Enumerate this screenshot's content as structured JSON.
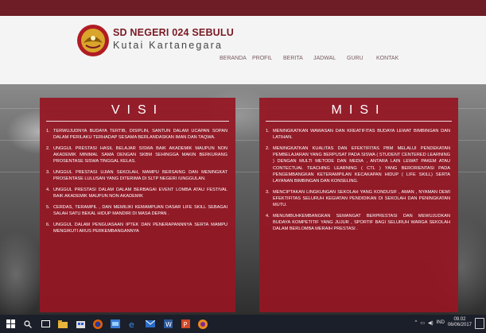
{
  "brand": {
    "name": "SD NEGERI 024 SEBULU",
    "subtitle": "Kutai Kartanegara"
  },
  "nav": [
    "BERANDA",
    "PROFIL",
    "BERITA",
    "JADWAL",
    "GURU",
    "KONTAK"
  ],
  "visi": {
    "title": "VISI",
    "items": [
      "TERWUJUDNYA BUDAYA TERTIB, DISIPLIN, SANTUN DALAM UCAPAN SOPAN DALAM PERILAKU TERHADAP SESAMA BERLANDASKAN IMAN DAN TAQWA.",
      "UNGGUL PRESTASI HASIL BELAJAR SISWA BAIK AKADEMIK MAUPUN NON AKADEMIK MINIMAL SAMA DENGAN SKBM SEHINGGA MAKIN BERKURANG PROSENTASE SISWA TINGGAL KELAS.",
      "UNGGUL PRESTASI UJIAN SEKOLAH, MAMPU BERSAING DAN MENINGKAT PROSENTASE LULUSAN YANG DITERIMA DI SLTP NEGERI /UNGGULAN.",
      "UNGGUL PRESTASI DALAM DALAM BERBAGAI EVENT LOMBA ATAU FESTIVAL BAIK AKADEMIK MAUPUN NON AKADEMIK",
      "CERDAS, TERAMPIL , DAN MEMILIKI KEMAMPUAN DASAR LIFE SKILL SEBAGAI SALAH SATU BEKAL HIDUP MANDIRI DI MASA DEPAN .",
      "UNGGUL DALAM PENGUASAAN IPTEK DAN PENERAPANNNYA SERTA MAMPU MENGIKUTI ARUS PERKEMBANGANNYA"
    ]
  },
  "misi": {
    "title": "MISI",
    "items": [
      "MENINGKATKAN WAWASAN DAN KREATIFITAS BUDAYA LEWAT BIMBINGAN DAN LATIHAN.",
      "MENINGKATKAN KUALITAS DAN EFEKTIFITAS PBM MELALUI PENDEKATAN PEMBELAJARAN YANG BERPUSAT PADA SISWA ( STUDENT CENTERED LEARNING ) DENGAN MULTI METODE DAN MEDIA , ANTARA LAIN LEWAT PAKEM ATAU CONTECTUAL TEACHING LEARNING ( CTL ) YANG BERORIENTASI PADA PENGEMBANGKAN KETERAMPILAN KECAKAPAN HIDUP ( LIFE SKILL) SERTA LAYANAN BIMBINGAN DAN KONSELING.",
      "MENCIPTAKAN LINGKUNGAN SEKOLAH YANG KONDUSIF , AMAN , NYAMAN DEMI EFEKTIFITAS SELURUH KEGIATAN PENDIDIKAN DI SEKOLAH DAN PENINGKATAN MUTU.",
      "MENUMBUHKEMBANGKAN SEMANGAT BERPRESTASI DAN MEWUJUDKAN BUDAYA KOMPETITIF YANG JUJUR , SPORTIF BAGI SELURUH WARGA SEKOLAH DALAM BERLOMBA MERAIH PRESTASI ."
    ]
  },
  "taskbar": {
    "language": "IND",
    "time": "09.02",
    "date": "06/06/2017"
  },
  "colors": {
    "panel": "#96162a",
    "brand": "#7a1a24",
    "taskbar": "#1b1f2a"
  }
}
